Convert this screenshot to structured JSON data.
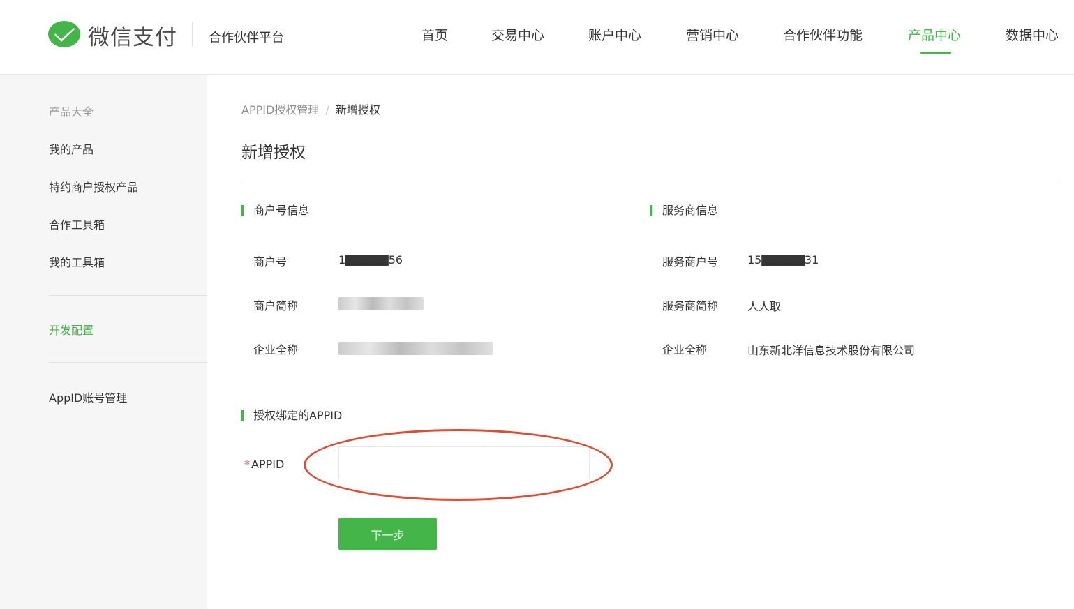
{
  "header": {
    "brand": "微信支付",
    "platform": "合作伙伴平台",
    "nav": [
      "首页",
      "交易中心",
      "账户中心",
      "营销中心",
      "合作伙伴功能",
      "产品中心",
      "数据中心"
    ],
    "active_nav": "产品中心"
  },
  "sidebar": {
    "title": "产品大全",
    "items": [
      "我的产品",
      "特约商户授权产品",
      "合作工具箱",
      "我的工具箱"
    ],
    "active": "开发配置",
    "bottom": "AppID账号管理"
  },
  "main": {
    "breadcrumb": {
      "parent": "APPID授权管理",
      "separator": "/",
      "current": "新增授权"
    },
    "title": "新增授权",
    "merchant": {
      "heading": "商户号信息",
      "merchant_no_label": "商户号",
      "merchant_no": "1▇▇▇▇▇56",
      "short_name_label": "商户简称",
      "short_name": "▇▇▇▇▇▇",
      "full_name_label": "企业全称",
      "full_name": "▇▇▇▇▇▇▇▇▇▇▇▇"
    },
    "provider": {
      "heading": "服务商信息",
      "provider_no_label": "服务商户号",
      "provider_no": "15▇▇▇▇▇31",
      "short_name_label": "服务商简称",
      "short_name": "人人取",
      "full_name_label": "企业全称",
      "full_name": "山东新北洋信息技术股份有限公司"
    },
    "appid_section": {
      "heading": "授权绑定的APPID",
      "required_mark": "*",
      "field_label": "APPID",
      "field_value": "",
      "next_button": "下一步"
    }
  },
  "colors": {
    "accent": "#44b549",
    "highlight": "#e04b33"
  }
}
